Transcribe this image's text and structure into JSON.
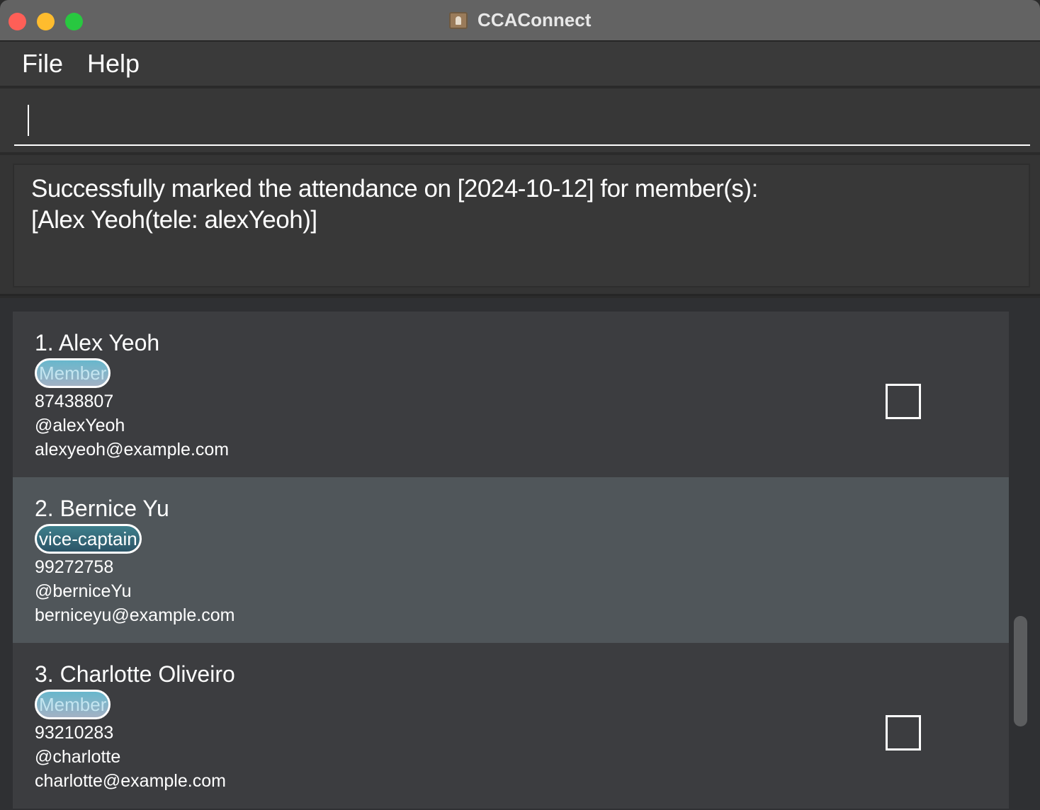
{
  "window": {
    "title": "CCAConnect",
    "icon": "contacts-book-icon"
  },
  "menu": {
    "file": "File",
    "help": "Help"
  },
  "command": {
    "value": "",
    "placeholder": ""
  },
  "result": {
    "line1": "Successfully marked the attendance on [2024-10-12] for member(s):",
    "line2": "[Alex Yeoh(tele: alexYeoh)]"
  },
  "persons": [
    {
      "name": "1. Alex Yeoh",
      "tag": "Member",
      "phone": "87438807",
      "telegram": "@alexYeoh",
      "email": "alexyeoh@example.com",
      "has_checkbox": true,
      "checked": false
    },
    {
      "name": "2. Bernice Yu",
      "tag": "vice-captain",
      "phone": "99272758",
      "telegram": "@berniceYu",
      "email": "berniceyu@example.com",
      "has_checkbox": false,
      "checked": false
    },
    {
      "name": "3. Charlotte Oliveiro",
      "tag": "Member",
      "phone": "93210283",
      "telegram": "@charlotte",
      "email": "charlotte@example.com",
      "has_checkbox": true,
      "checked": false
    }
  ],
  "colors": {
    "titlebar": "#636363",
    "card_dark": "#3c3d40",
    "card_selected": "#50565a",
    "tag_member": "#68b7cc",
    "tag_vice_captain": "#3e7f8c"
  }
}
